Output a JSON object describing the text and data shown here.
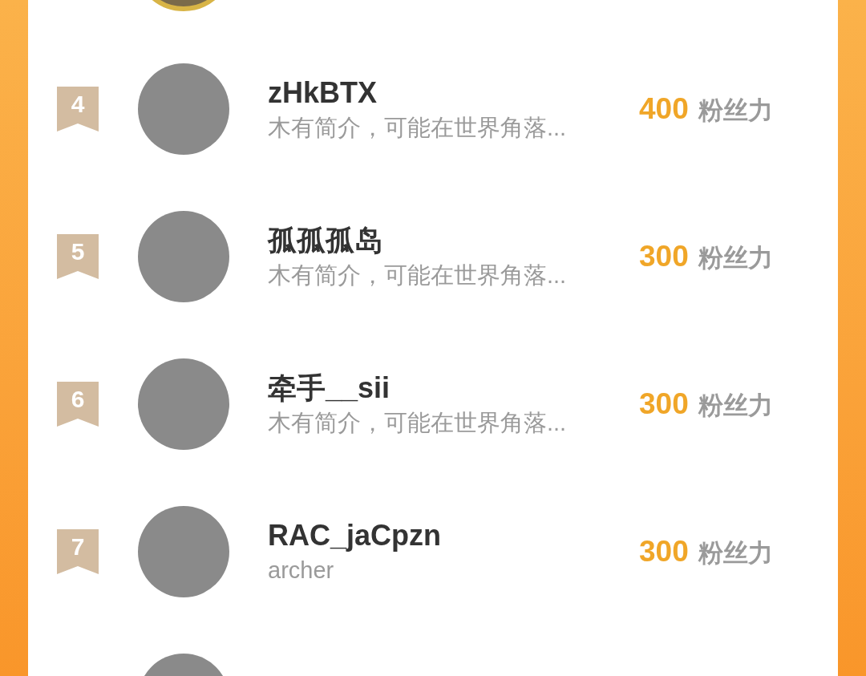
{
  "rows": [
    {
      "kind": "cut_top",
      "top_three": true
    },
    {
      "kind": "full",
      "rank": "4",
      "name": "zHkBTX",
      "bio": "木有简介，可能在世界角落...",
      "score": "400",
      "score_unit": "粉丝力"
    },
    {
      "kind": "full",
      "rank": "5",
      "name": "孤孤孤岛",
      "bio": "木有简介，可能在世界角落...",
      "score": "300",
      "score_unit": "粉丝力"
    },
    {
      "kind": "full",
      "rank": "6",
      "name": "牵手__sii",
      "bio": "木有简介，可能在世界角落...",
      "score": "300",
      "score_unit": "粉丝力"
    },
    {
      "kind": "full",
      "rank": "7",
      "name": "RAC_jaCpzn",
      "bio": "archer",
      "score": "300",
      "score_unit": "粉丝力"
    },
    {
      "kind": "cut_bottom"
    }
  ]
}
